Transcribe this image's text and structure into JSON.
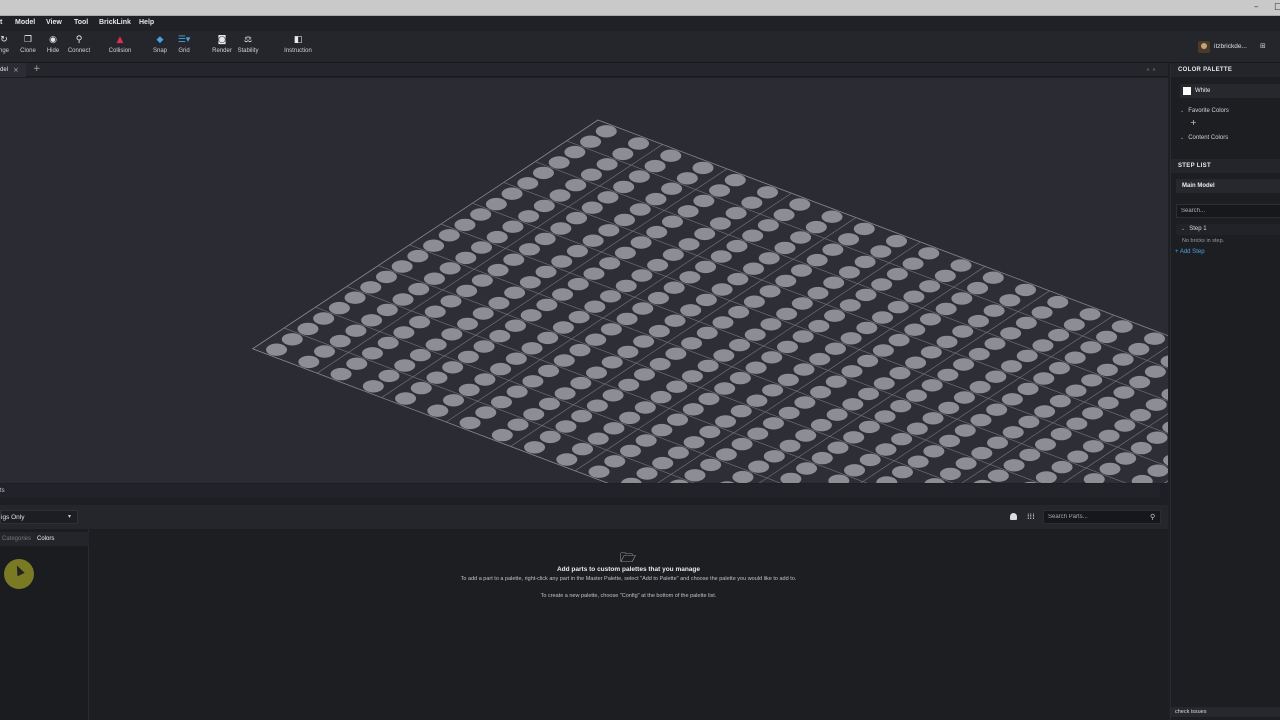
{
  "menu": [
    "t",
    "Model",
    "View",
    "Tool",
    "BrickLink",
    "Help"
  ],
  "toolbar": [
    {
      "label": "nge",
      "icon": "rotate-icon"
    },
    {
      "label": "Clone",
      "icon": "clone-icon"
    },
    {
      "label": "Hide",
      "icon": "hide-icon"
    },
    {
      "label": "Connect",
      "icon": "connect-icon"
    },
    {
      "label": "Collision",
      "icon": "collision-icon"
    },
    {
      "label": "Snap",
      "icon": "snap-icon"
    },
    {
      "label": "Grid",
      "icon": "grid-icon"
    },
    {
      "label": "Render",
      "icon": "camera-icon"
    },
    {
      "label": "Stability",
      "icon": "stability-icon"
    },
    {
      "label": "Instruction",
      "icon": "instruction-icon"
    }
  ],
  "user": {
    "name": "itzbrickde..."
  },
  "tabs": {
    "model_tab": "del"
  },
  "status_strip": "ts",
  "palette": {
    "selected": "igs Only",
    "tabs": {
      "categories": "Categories",
      "colors": "Colors"
    },
    "search_placeholder": "Search Parts...",
    "empty_title": "Add parts to custom palettes that you manage",
    "empty_line1": "To add a part to a palette, right-click any part in the Master Palette, select \"Add to Palette\" and choose the palette you would like to add to.",
    "empty_line2": "To create a new palette, choose \"Config\" at the bottom of the palette list."
  },
  "right_panel": {
    "color_palette_header": "COLOR PALETTE",
    "selected_color": {
      "name": "White",
      "hex": "#ffffff"
    },
    "favorite_colors": "Favorite Colors",
    "content_colors": "Content Colors",
    "step_list_header": "STEP LIST",
    "main_model": "Main Model",
    "search_placeholder": "Search...",
    "step1": "Step 1",
    "no_bricks": "No bricks in step.",
    "add_step": "Add Step",
    "check_issues": "check issues"
  },
  "colors": {
    "accent_blue": "#4aa3df",
    "collision_red": "#d9304f",
    "stud": "#8d8d94"
  }
}
